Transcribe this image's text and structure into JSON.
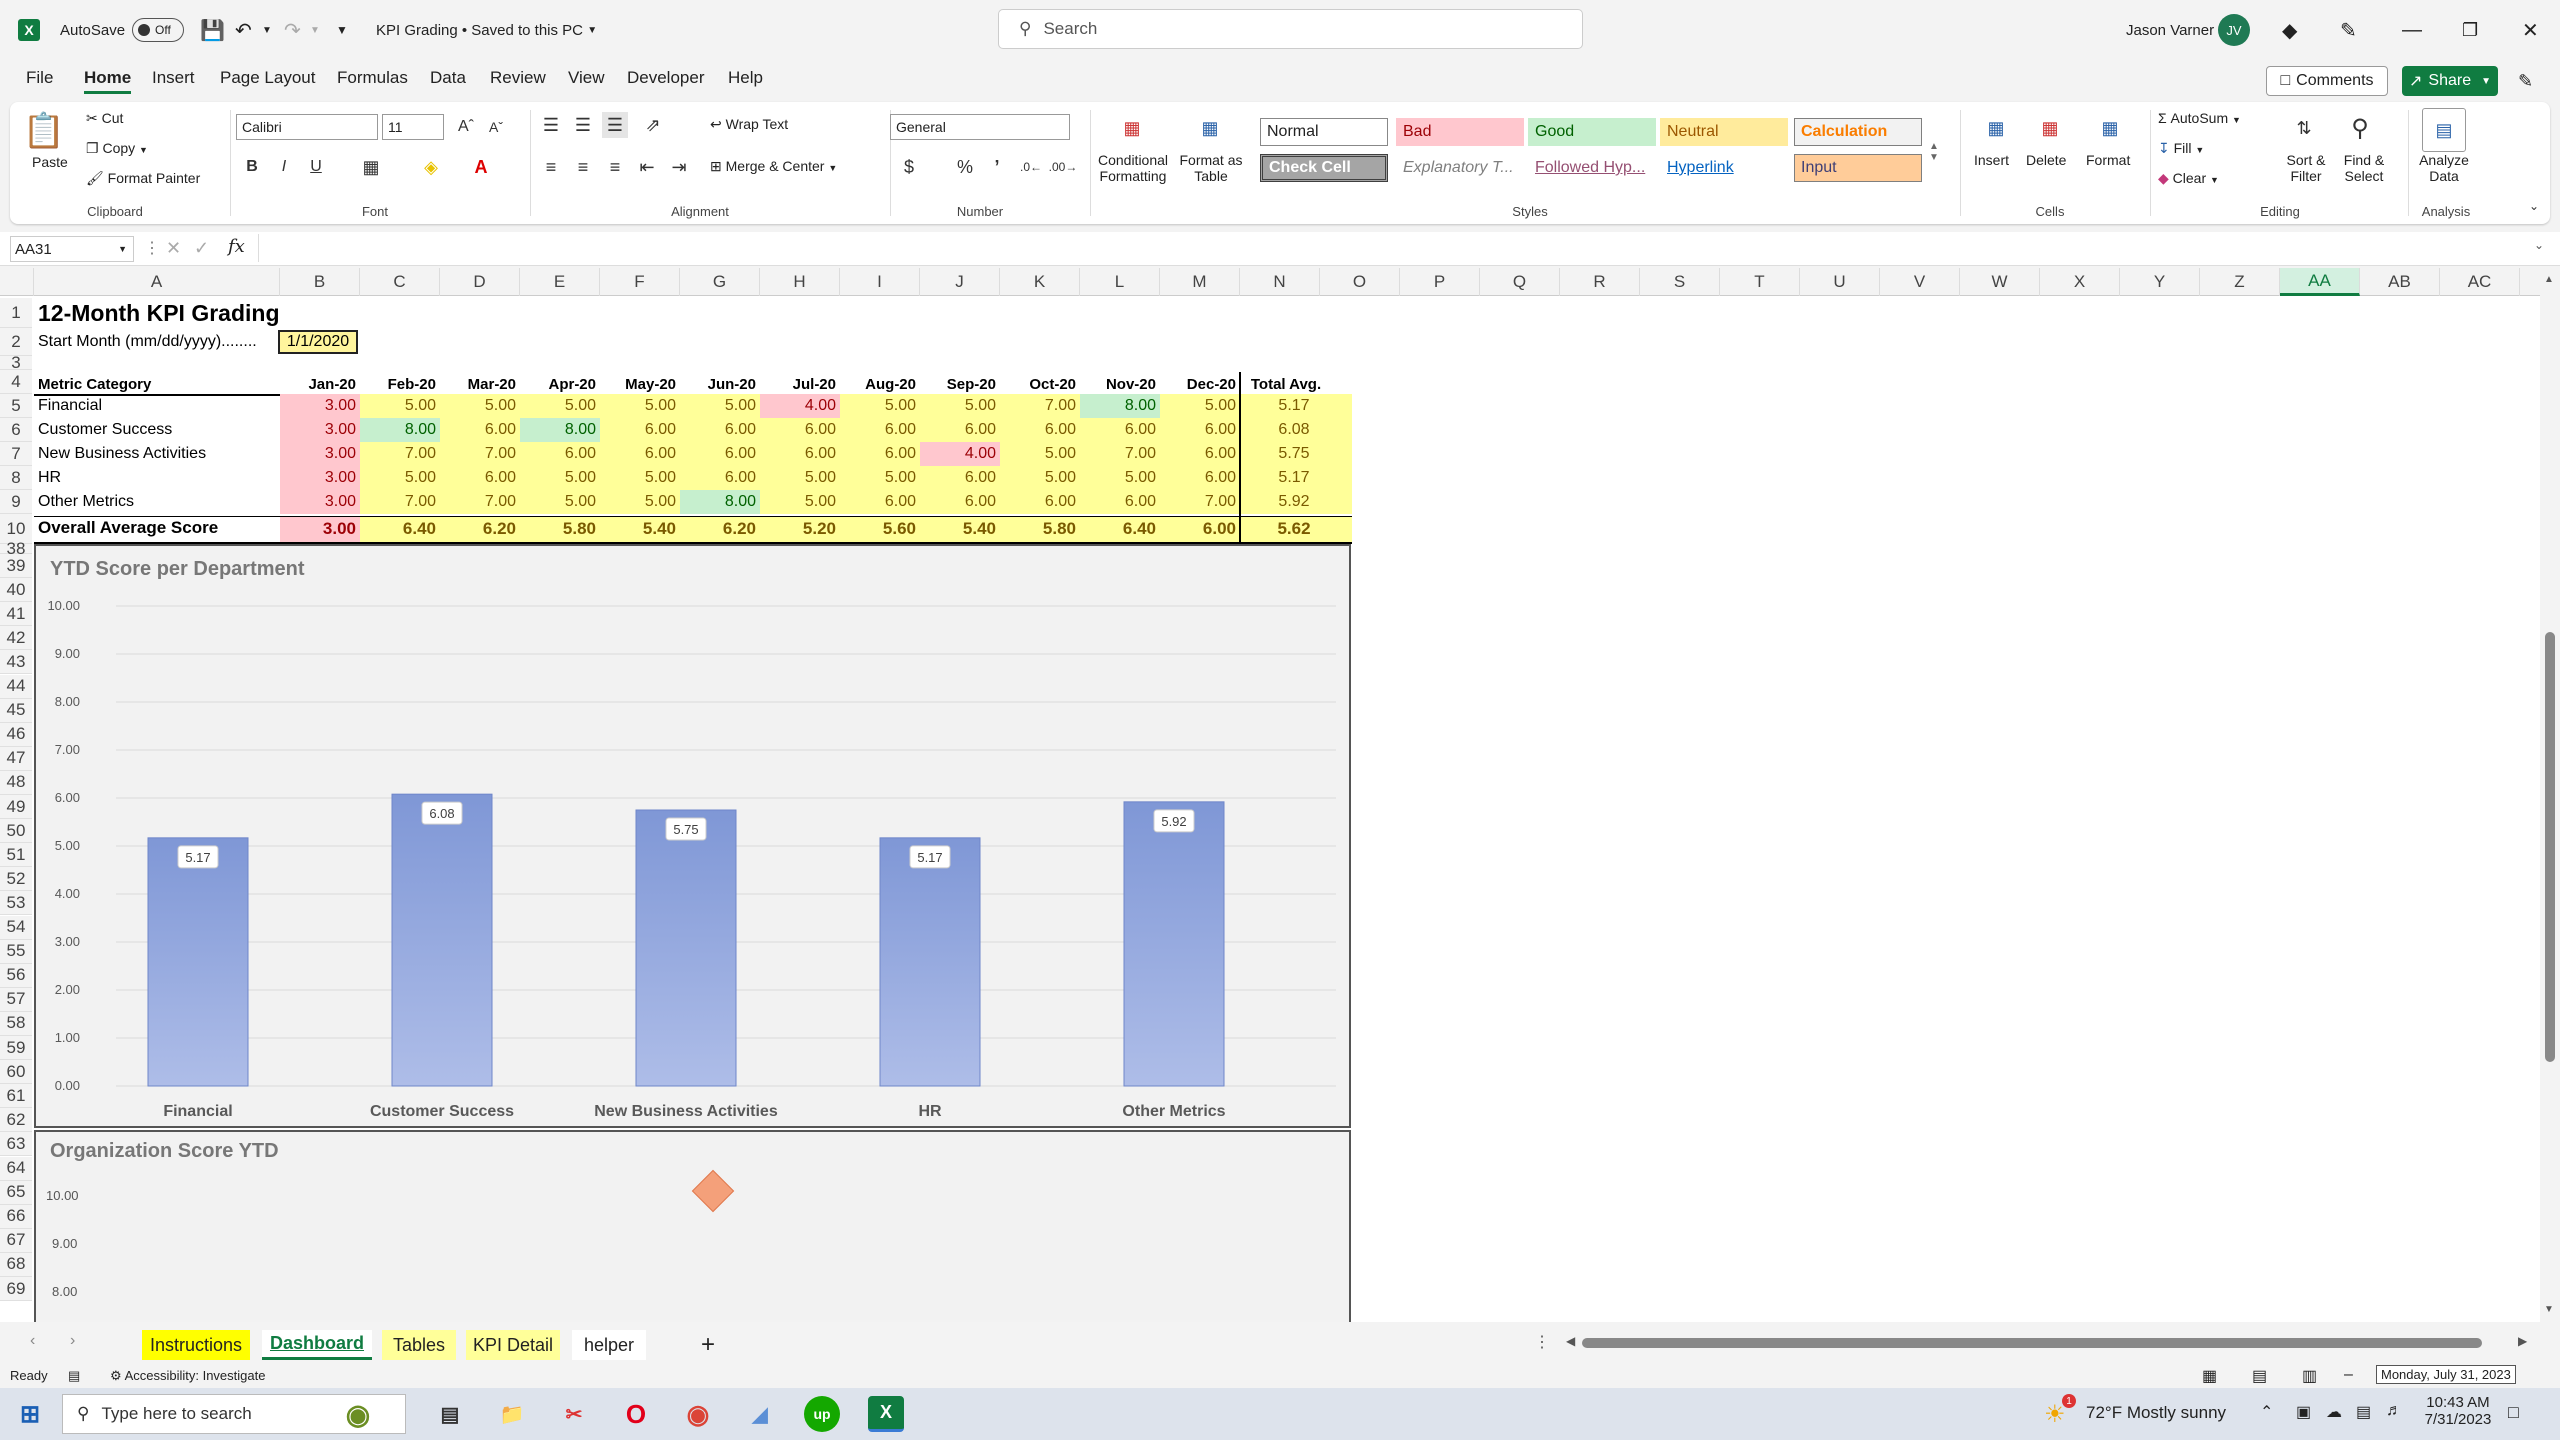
{
  "titlebar": {
    "autosave_label": "AutoSave",
    "autosave_state": "Off",
    "doc_title": "KPI Grading • Saved to this PC",
    "search_placeholder": "Search",
    "user_name": "Jason Varner",
    "user_initials": "JV"
  },
  "menu": {
    "items": [
      "File",
      "Home",
      "Insert",
      "Page Layout",
      "Formulas",
      "Data",
      "Review",
      "View",
      "Developer",
      "Help"
    ],
    "active": "Home",
    "comments": "Comments",
    "share": "Share"
  },
  "ribbon": {
    "clipboard": {
      "paste": "Paste",
      "cut": "Cut",
      "copy": "Copy",
      "format_painter": "Format Painter",
      "label": "Clipboard"
    },
    "font": {
      "name": "Calibri",
      "size": "11",
      "label": "Font"
    },
    "alignment": {
      "wrap": "Wrap Text",
      "merge": "Merge & Center",
      "label": "Alignment"
    },
    "number": {
      "format": "General",
      "label": "Number"
    },
    "styles": {
      "conditional1": "Conditional",
      "conditional2": "Formatting",
      "format_table1": "Format as",
      "format_table2": "Table",
      "label": "Styles",
      "cells": [
        "Normal",
        "Bad",
        "Good",
        "Neutral",
        "Calculation",
        "Check Cell",
        "Explanatory T...",
        "Followed Hyp...",
        "Hyperlink",
        "Input"
      ]
    },
    "cells": {
      "insert": "Insert",
      "delete": "Delete",
      "format": "Format",
      "label": "Cells"
    },
    "editing": {
      "autosum": "AutoSum",
      "fill": "Fill",
      "clear": "Clear",
      "sort1": "Sort &",
      "sort2": "Filter",
      "find1": "Find &",
      "find2": "Select",
      "label": "Editing"
    },
    "analysis": {
      "analyze1": "Analyze",
      "analyze2": "Data",
      "label": "Analysis"
    }
  },
  "formula_bar": {
    "name_box": "AA31",
    "fx": "fx",
    "formula": ""
  },
  "columns": [
    "A",
    "B",
    "C",
    "D",
    "E",
    "F",
    "G",
    "H",
    "I",
    "J",
    "K",
    "L",
    "M",
    "N",
    "O",
    "P",
    "Q",
    "R",
    "S",
    "T",
    "U",
    "V",
    "W",
    "X",
    "Y",
    "Z",
    "AA",
    "AB",
    "AC"
  ],
  "selected_column": "AA",
  "sheet": {
    "title": "12-Month KPI Grading",
    "start_label": "Start Month (mm/dd/yyyy)........",
    "start_value": "1/1/2020",
    "header_label": "Metric Category",
    "months": [
      "Jan-20",
      "Feb-20",
      "Mar-20",
      "Apr-20",
      "May-20",
      "Jun-20",
      "Jul-20",
      "Aug-20",
      "Sep-20",
      "Oct-20",
      "Nov-20",
      "Dec-20"
    ],
    "total_label": "Total Avg.",
    "rows": [
      {
        "name": "Financial",
        "values": [
          "3.00",
          "5.00",
          "5.00",
          "5.00",
          "5.00",
          "5.00",
          "4.00",
          "5.00",
          "5.00",
          "7.00",
          "8.00",
          "5.00"
        ],
        "total": "5.17"
      },
      {
        "name": "Customer Success",
        "values": [
          "3.00",
          "8.00",
          "6.00",
          "8.00",
          "6.00",
          "6.00",
          "6.00",
          "6.00",
          "6.00",
          "6.00",
          "6.00",
          "6.00"
        ],
        "total": "6.08"
      },
      {
        "name": "New Business Activities",
        "values": [
          "3.00",
          "7.00",
          "7.00",
          "6.00",
          "6.00",
          "6.00",
          "6.00",
          "6.00",
          "4.00",
          "5.00",
          "7.00",
          "6.00"
        ],
        "total": "5.75"
      },
      {
        "name": "HR",
        "values": [
          "3.00",
          "5.00",
          "6.00",
          "5.00",
          "5.00",
          "6.00",
          "5.00",
          "5.00",
          "6.00",
          "5.00",
          "5.00",
          "6.00"
        ],
        "total": "5.17"
      },
      {
        "name": "Other Metrics",
        "values": [
          "3.00",
          "7.00",
          "7.00",
          "5.00",
          "5.00",
          "8.00",
          "5.00",
          "6.00",
          "6.00",
          "6.00",
          "6.00",
          "7.00"
        ],
        "total": "5.92"
      }
    ],
    "overall_label": "Overall Average Score",
    "overall": [
      "3.00",
      "6.40",
      "6.20",
      "5.80",
      "5.40",
      "6.20",
      "5.20",
      "5.60",
      "5.40",
      "5.80",
      "6.40",
      "6.00"
    ],
    "overall_total": "5.62",
    "row_numbers_top": [
      "1",
      "2",
      "3",
      "4",
      "5",
      "6",
      "7",
      "8",
      "9",
      "10"
    ],
    "row_numbers_bottom": [
      "38",
      "39",
      "40",
      "41",
      "42",
      "43",
      "44",
      "45",
      "46",
      "47",
      "48",
      "49",
      "50",
      "51",
      "52",
      "53",
      "54",
      "55",
      "56",
      "57",
      "58",
      "59",
      "60",
      "61",
      "62",
      "63",
      "64",
      "65",
      "66",
      "67",
      "68",
      "69"
    ]
  },
  "chart_data": [
    {
      "type": "bar",
      "title": "YTD Score per Department",
      "categories": [
        "Financial",
        "Customer Success",
        "New Business Activities",
        "HR",
        "Other Metrics"
      ],
      "values": [
        5.17,
        6.08,
        5.75,
        5.17,
        5.92
      ],
      "ylim": [
        0,
        10
      ],
      "yticks": [
        "0.00",
        "1.00",
        "2.00",
        "3.00",
        "4.00",
        "5.00",
        "6.00",
        "7.00",
        "8.00",
        "9.00",
        "10.00"
      ],
      "grid": true,
      "data_labels": [
        "5.17",
        "6.08",
        "5.75",
        "5.17",
        "5.92"
      ],
      "bar_color": "#8fa3db"
    },
    {
      "type": "scatter",
      "title": "Organization Score YTD",
      "yticks_visible": [
        "10.00",
        "9.00",
        "8.00"
      ],
      "marker_color": "#f4a07a"
    }
  ],
  "tabs": {
    "items": [
      "Instructions",
      "Dashboard",
      "Tables",
      "KPI Detail",
      "helper"
    ],
    "active": "Dashboard",
    "add": "+"
  },
  "status": {
    "ready": "Ready",
    "accessibility": "Accessibility: Investigate",
    "tooltip": "Monday, July 31, 2023"
  },
  "taskbar": {
    "search_placeholder": "Type here to search",
    "weather": "72°F  Mostly sunny",
    "time": "10:43 AM",
    "date": "7/31/2023",
    "notif": "1"
  }
}
